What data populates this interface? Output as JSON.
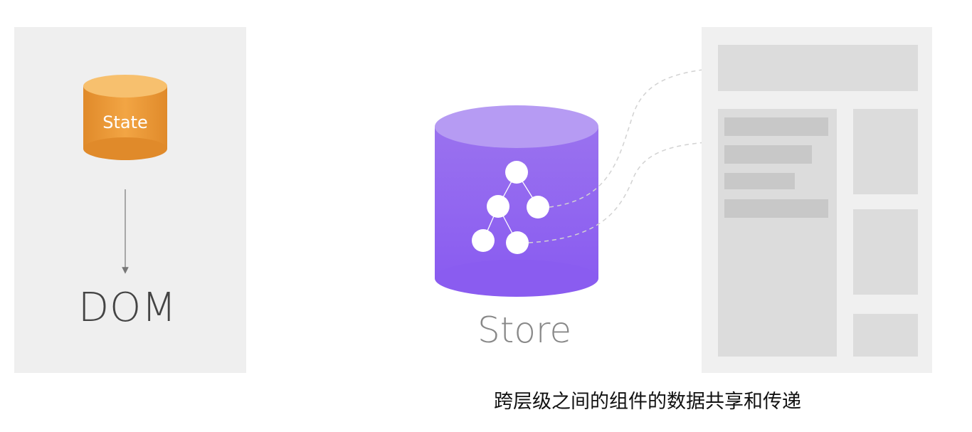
{
  "left": {
    "state_label": "State",
    "dom_label": "DOM"
  },
  "center": {
    "store_label": "Store"
  },
  "caption": "跨层级之间的组件的数据共享和传递",
  "colors": {
    "state_orange": "#f0a43a",
    "store_purple": "#8b63ec",
    "store_top": "#b69bf3",
    "panel_bg": "#efefef",
    "block_gray": "#dcdcdc",
    "bar_gray": "#c8c8c8"
  }
}
